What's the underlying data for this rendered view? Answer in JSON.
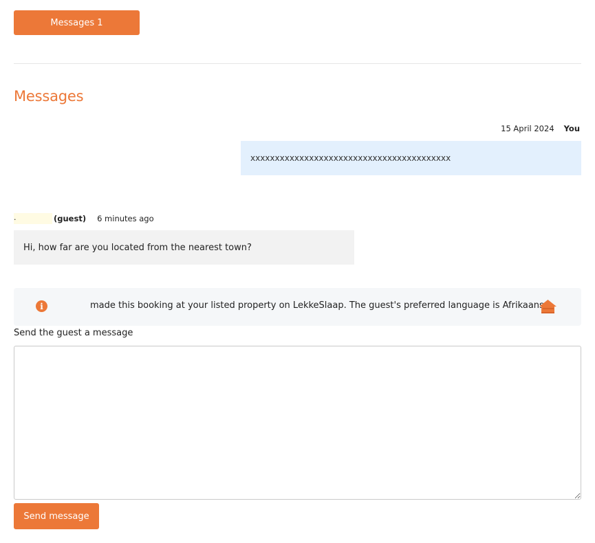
{
  "tabs": {
    "messages_label": "Messages 1"
  },
  "section": {
    "title": "Messages"
  },
  "thread": [
    {
      "direction": "outgoing",
      "date": "15 April 2024",
      "sender": "You",
      "text": "xxxxxxxxxxxxxxxxxxxxxxxxxxxxxxxxxxxxxxxxx"
    },
    {
      "direction": "incoming",
      "sender_name": ".",
      "sender_role": "(guest)",
      "time": "6 minutes ago",
      "text": "Hi, how far are you located from the nearest town?"
    }
  ],
  "info_banner": {
    "text": "made this booking at your listed property on LekkeSlaap. The guest's preferred language is Afrikaans.",
    "icon": "info-icon",
    "trailing_icon": "home-icon"
  },
  "composer": {
    "label": "Send the guest a message",
    "placeholder": "",
    "value": "",
    "send_label": "Send message"
  },
  "colors": {
    "accent": "#ec7838",
    "outgoing_bubble": "#e3f0fd",
    "incoming_bubble": "#f2f2f2",
    "info_bg": "#f5f7f9"
  }
}
